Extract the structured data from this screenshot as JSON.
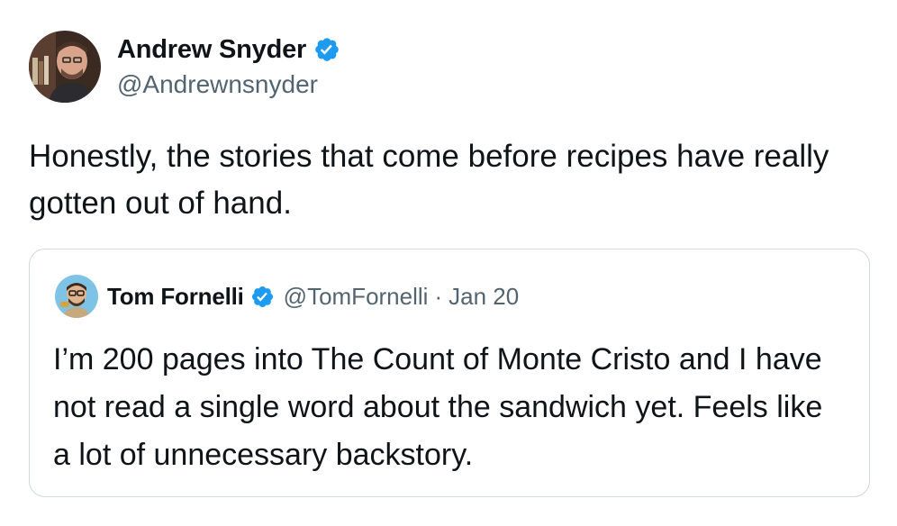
{
  "tweet": {
    "author": {
      "display_name": "Andrew Snyder",
      "handle": "@Andrewnsnyder",
      "verified": true,
      "avatar_icon": "user-avatar-photo"
    },
    "text": "Honestly, the stories that come before recipes have really gotten out of hand.",
    "quoted_tweet": {
      "author": {
        "display_name": "Tom Fornelli",
        "handle": "@TomFornelli",
        "verified": true,
        "avatar_icon": "user-avatar-cartoon"
      },
      "separator": "·",
      "date": "Jan 20",
      "text": "I’m 200 pages into The Count of Monte Cristo and I have not read a single word about the sandwich yet. Feels like a lot of unnecessary backstory."
    }
  },
  "colors": {
    "verified_badge": "#1d9bf0",
    "secondary_text": "#536471",
    "border": "#cfd9de",
    "primary_text": "#0f1419"
  }
}
